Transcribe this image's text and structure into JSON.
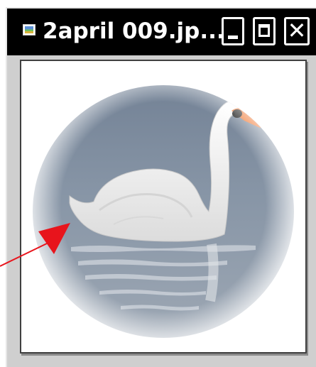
{
  "window": {
    "title": "2april 009.jp...",
    "icon": "image-file-icon",
    "controls": {
      "minimize_icon": "minimize-icon",
      "maximize_icon": "maximize-icon",
      "close_icon": "close-icon",
      "close_glyph": "✕"
    }
  },
  "image": {
    "subject_icon": "swan-photo",
    "vignette_color": "#ffffff",
    "water_color": "#8a97a6"
  },
  "annotation": {
    "arrow_color": "#e8141c",
    "arrow_icon": "red-arrow-icon"
  }
}
